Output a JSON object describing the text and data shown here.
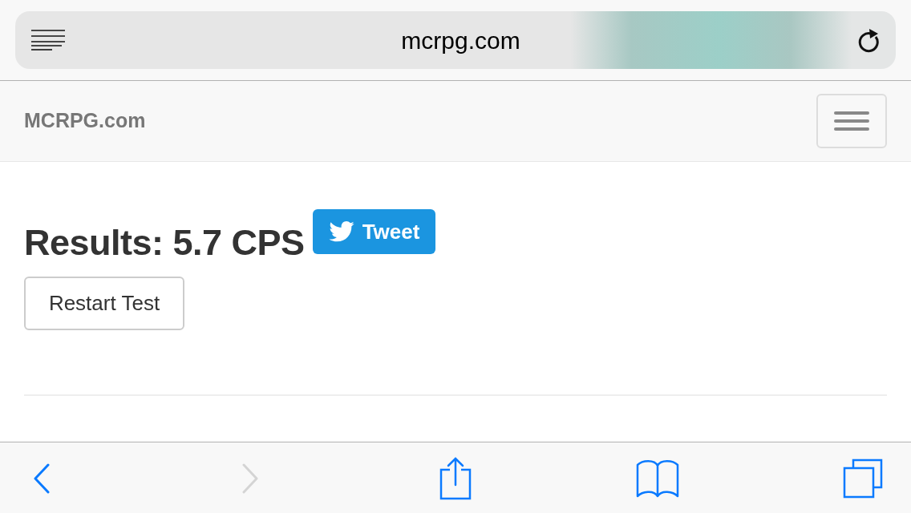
{
  "browser": {
    "url": "mcrpg.com"
  },
  "navbar": {
    "brand": "MCRPG.com"
  },
  "results": {
    "heading": "Results: 5.7 CPS",
    "tweet_button": "Tweet",
    "restart_button": "Restart Test"
  },
  "toolbar": {
    "buttons": [
      {
        "kind": "back",
        "disabled": false
      },
      {
        "kind": "forward",
        "disabled": true
      },
      {
        "kind": "share",
        "disabled": false
      },
      {
        "kind": "bookmarks",
        "disabled": false
      },
      {
        "kind": "tabs",
        "disabled": false
      }
    ]
  }
}
